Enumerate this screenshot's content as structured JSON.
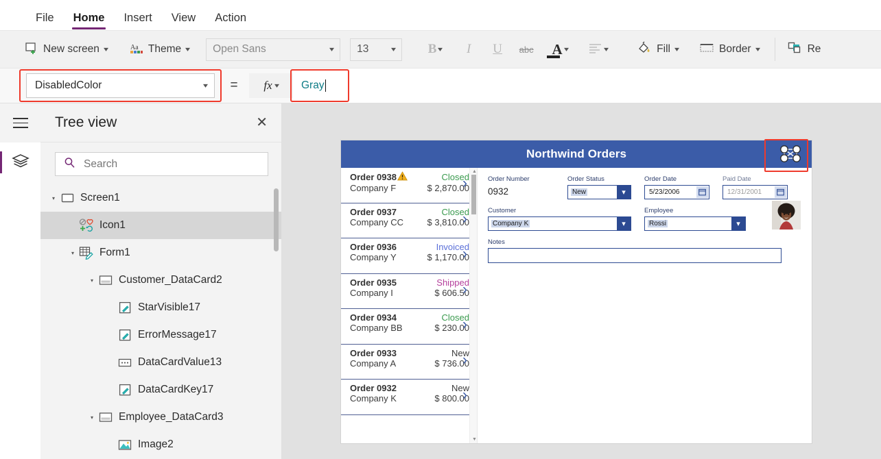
{
  "menubar": {
    "items": [
      {
        "label": "File",
        "active": false
      },
      {
        "label": "Home",
        "active": true
      },
      {
        "label": "Insert",
        "active": false
      },
      {
        "label": "View",
        "active": false
      },
      {
        "label": "Action",
        "active": false
      }
    ]
  },
  "ribbon": {
    "new_screen": "New screen",
    "theme": "Theme",
    "font_name": "Open Sans",
    "font_size": "13",
    "bold": "B",
    "italic": "I",
    "underline": "U",
    "strikethrough": "abc",
    "font_color": "A",
    "align": "align",
    "fill": "Fill",
    "border": "Border",
    "reorder": "Re"
  },
  "formula_bar": {
    "property": "DisabledColor",
    "equals": "=",
    "fx": "fx",
    "value": "Gray",
    "highlight_color": "#ef3a2c",
    "value_color": "#0e7c86"
  },
  "tree_view": {
    "title": "Tree view",
    "close": "✕",
    "search_placeholder": "Search",
    "search_value": "",
    "items": [
      {
        "label": "Screen1",
        "depth": 0,
        "caret": "down",
        "icon": "screen-icon",
        "selected": false
      },
      {
        "label": "Icon1",
        "depth": 1,
        "caret": "none",
        "icon": "icon-control-icon",
        "selected": true
      },
      {
        "label": "Form1",
        "depth": 1,
        "caret": "down",
        "icon": "form-icon",
        "selected": false
      },
      {
        "label": "Customer_DataCard2",
        "depth": 2,
        "caret": "down",
        "icon": "datacard-icon",
        "selected": false
      },
      {
        "label": "StarVisible17",
        "depth": 3,
        "caret": "none",
        "icon": "label-icon",
        "selected": false
      },
      {
        "label": "ErrorMessage17",
        "depth": 3,
        "caret": "none",
        "icon": "label-icon",
        "selected": false
      },
      {
        "label": "DataCardValue13",
        "depth": 3,
        "caret": "none",
        "icon": "combobox-icon",
        "selected": false
      },
      {
        "label": "DataCardKey17",
        "depth": 3,
        "caret": "none",
        "icon": "label-icon",
        "selected": false
      },
      {
        "label": "Employee_DataCard3",
        "depth": 2,
        "caret": "down",
        "icon": "datacard-icon",
        "selected": false
      },
      {
        "label": "Image2",
        "depth": 3,
        "caret": "none",
        "icon": "image-icon",
        "selected": false
      }
    ]
  },
  "canvas": {
    "app_title": "Northwind Orders",
    "header_color": "#3b5ca8",
    "icon1_name": "variable-hub-icon",
    "gallery": {
      "items": [
        {
          "order": "Order 0938",
          "company": "Company F",
          "status": "Closed",
          "status_color": "#3a9a4e",
          "amount": "$ 2,870.00",
          "warning": true
        },
        {
          "order": "Order 0937",
          "company": "Company CC",
          "status": "Closed",
          "status_color": "#3a9a4e",
          "amount": "$ 3,810.00",
          "warning": false
        },
        {
          "order": "Order 0936",
          "company": "Company Y",
          "status": "Invoiced",
          "status_color": "#5a6fd8",
          "amount": "$ 1,170.00",
          "warning": false
        },
        {
          "order": "Order 0935",
          "company": "Company I",
          "status": "Shipped",
          "status_color": "#b5409c",
          "amount": "$ 606.50",
          "warning": false
        },
        {
          "order": "Order 0934",
          "company": "Company BB",
          "status": "Closed",
          "status_color": "#3a9a4e",
          "amount": "$ 230.00",
          "warning": false
        },
        {
          "order": "Order 0933",
          "company": "Company A",
          "status": "New",
          "status_color": "#3c3c3c",
          "amount": "$ 736.00",
          "warning": false
        },
        {
          "order": "Order 0932",
          "company": "Company K",
          "status": "New",
          "status_color": "#3c3c3c",
          "amount": "$ 800.00",
          "warning": false
        }
      ]
    },
    "detail": {
      "order_number_label": "Order Number",
      "order_number_value": "0932",
      "order_status_label": "Order Status",
      "order_status_value": "New",
      "order_date_label": "Order Date",
      "order_date_value": "5/23/2006",
      "paid_date_label": "Paid Date",
      "paid_date_value": "12/31/2001",
      "customer_label": "Customer",
      "customer_value": "Company K",
      "employee_label": "Employee",
      "employee_value": "Rossi",
      "notes_label": "Notes",
      "notes_value": ""
    }
  }
}
